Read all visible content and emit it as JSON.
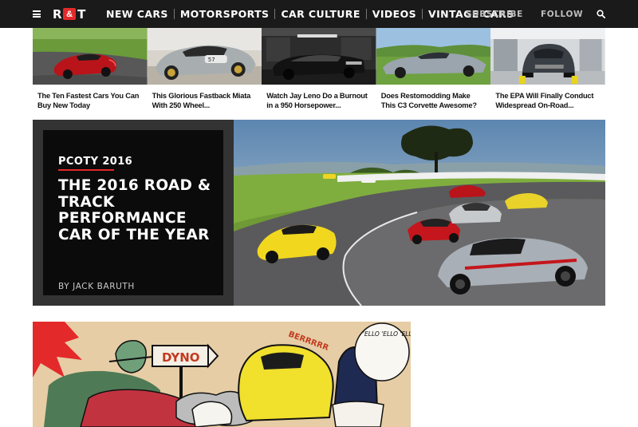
{
  "nav": {
    "logo": {
      "left": "R",
      "mid": "&",
      "right": "T"
    },
    "links": [
      "NEW CARS",
      "MOTORSPORTS",
      "CAR CULTURE",
      "VIDEOS",
      "VINTAGE CARS"
    ],
    "right_links": [
      "SUBSCRIBE",
      "FOLLOW"
    ]
  },
  "thumbs": [
    {
      "caption": "The Ten Fastest Cars You Can Buy New Today"
    },
    {
      "caption": "This Glorious Fastback Miata With 250 Wheel..."
    },
    {
      "caption": "Watch Jay Leno Do a Burnout in a 950 Horsepower..."
    },
    {
      "caption": "Does Restomodding Make This C3 Corvette Awesome?"
    },
    {
      "caption": "The EPA Will Finally Conduct Widespread On-Road..."
    }
  ],
  "hero": {
    "kicker": "PCOTY 2016",
    "title": "THE 2016 ROAD & TRACK PERFORMANCE CAR OF THE YEAR",
    "byline": "BY JACK BARUTH"
  },
  "cartoon": {
    "sign": "DYNO",
    "sound": "BERRRRR",
    "bubble": "'ELLO 'ELLO 'ELLO WOT'S ALL THIS THEN?"
  },
  "colors": {
    "accent": "#e4292a",
    "nav_bg": "#1a1a1a"
  }
}
